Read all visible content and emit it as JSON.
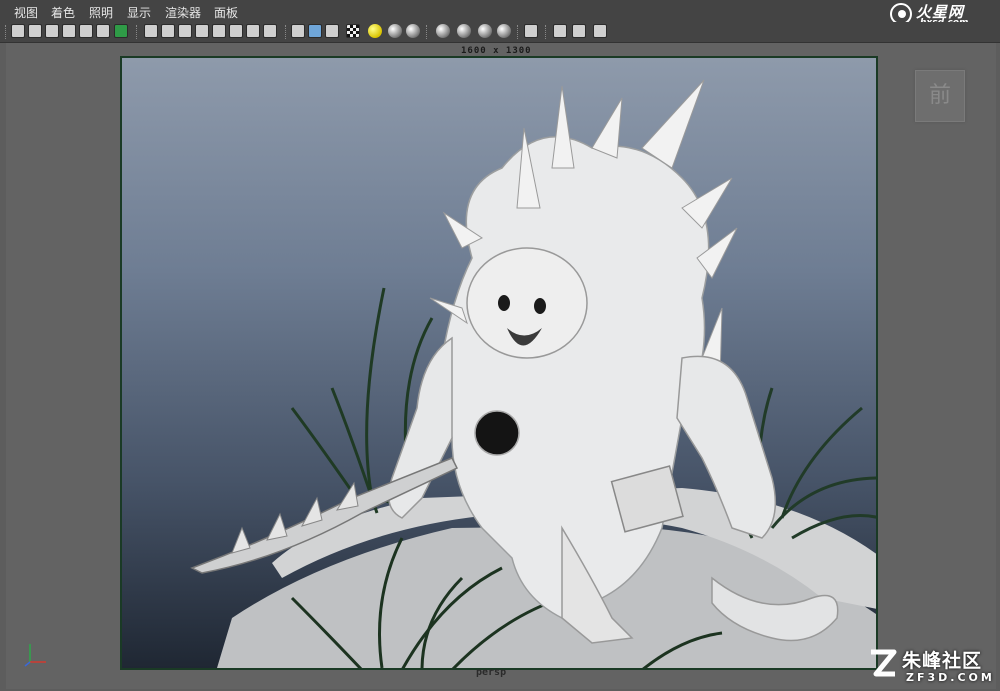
{
  "menu": {
    "items": [
      "视图",
      "着色",
      "照明",
      "显示",
      "渲染器",
      "面板"
    ]
  },
  "logo": {
    "cn": "火星网",
    "url": "hxsd.com"
  },
  "viewport": {
    "resolution_label": "1600 x 1300",
    "camera_label": "persp",
    "view_cube_label": "前"
  },
  "watermark": {
    "cn": "朱峰社区",
    "en": "ZF3D.COM"
  },
  "colors": {
    "menubar": "#444444",
    "viewport_bg": "#636363",
    "gradient_top": "#8e9aab",
    "gradient_bottom": "#1f2733",
    "gate_border": "#1a3a25"
  }
}
